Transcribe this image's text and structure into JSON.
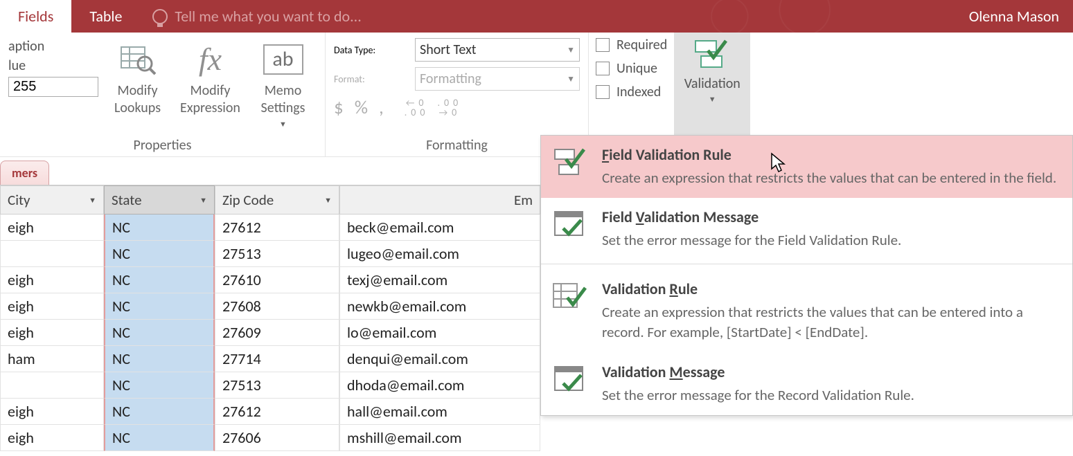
{
  "titlebar": {
    "tab_fields": "Fields",
    "tab_table": "Table",
    "tellme_placeholder": "Tell me what you want to do...",
    "user": "Olenna Mason"
  },
  "ribbon": {
    "properties": {
      "caption_label": "aption",
      "value_label": "lue",
      "value_input": "255",
      "modify_lookups": "Modify\nLookups",
      "modify_expression": "Modify\nExpression",
      "memo_settings": "Memo\nSettings",
      "group_label": "Properties"
    },
    "formatting": {
      "datatype_label": "Data Type:",
      "datatype_value": "Short Text",
      "format_label": "Format:",
      "format_value": "Formatting",
      "sym_currency": "$",
      "sym_percent": "%",
      "sym_comma": ",",
      "sym_dec_inc": "←0 .00",
      "sym_dec_dec": ".00 →0",
      "group_label": "Formatting"
    },
    "flags": {
      "required": "Required",
      "unique": "Unique",
      "indexed": "Indexed"
    },
    "validation": {
      "label": "Validation"
    }
  },
  "sheet": {
    "tab_label": "mers",
    "columns": [
      "City",
      "State",
      "Zip Code",
      "Em"
    ],
    "rows": [
      {
        "city": "eigh",
        "state": "NC",
        "zip": "27612",
        "email": "beck@email.com"
      },
      {
        "city": "",
        "state": "NC",
        "zip": "27513",
        "email": "lugeo@email.com"
      },
      {
        "city": "eigh",
        "state": "NC",
        "zip": "27610",
        "email": "texj@email.com"
      },
      {
        "city": "eigh",
        "state": "NC",
        "zip": "27608",
        "email": "newkb@email.com"
      },
      {
        "city": "eigh",
        "state": "NC",
        "zip": "27609",
        "email": "lo@email.com"
      },
      {
        "city": "ham",
        "state": "NC",
        "zip": "27714",
        "email": "denqui@email.com"
      },
      {
        "city": "",
        "state": "NC",
        "zip": "27513",
        "email": "dhoda@email.com"
      },
      {
        "city": "eigh",
        "state": "NC",
        "zip": "27612",
        "email": "hall@email.com"
      },
      {
        "city": "eigh",
        "state": "NC",
        "zip": "27606",
        "email": "mshill@email.com"
      }
    ]
  },
  "popup": {
    "items": [
      {
        "title_pre": "",
        "title_u": "F",
        "title_post": "ield Validation Rule",
        "desc": "Create an expression that restricts the values that can be entered in the field."
      },
      {
        "title_pre": "Field ",
        "title_u": "V",
        "title_post": "alidation Message",
        "desc": "Set the error message for the Field Validation Rule."
      },
      {
        "title_pre": "Validation ",
        "title_u": "R",
        "title_post": "ule",
        "desc": "Create an expression that restricts the values that can be entered into a record.  For example, [StartDate] < [EndDate]."
      },
      {
        "title_pre": "Validation ",
        "title_u": "M",
        "title_post": "essage",
        "desc": "Set the error message for the Record Validation Rule."
      }
    ]
  }
}
